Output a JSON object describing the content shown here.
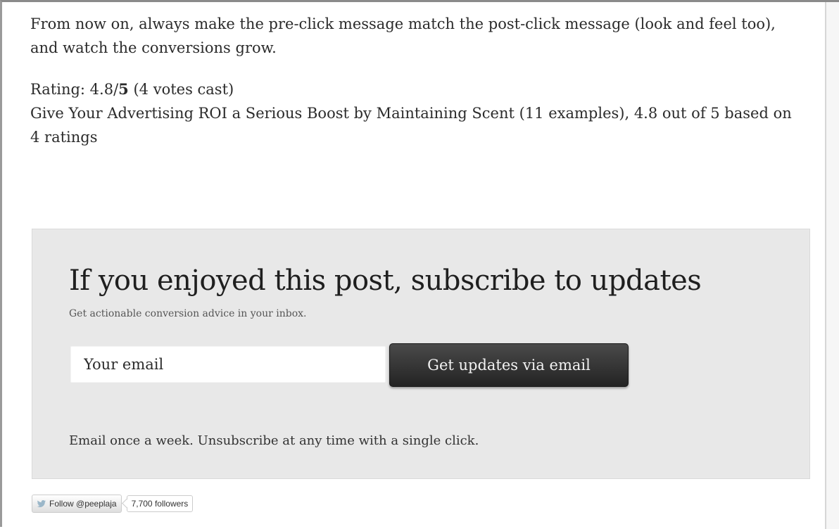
{
  "article": {
    "closing_paragraph": "From now on, always make the pre-click message match the post-click message (look and feel too), and watch the conversions grow.",
    "rating": {
      "prefix": "Rating: 4.8/",
      "max": "5",
      "votes": " (4 votes cast)",
      "value": 4.8,
      "scale": 5
    },
    "rating_summary": "Give Your Advertising ROI a Serious Boost by Maintaining Scent (11 examples), 4.8 out of 5 based on 4 ratings"
  },
  "subscribe": {
    "title": "If you enjoyed this post, subscribe to updates",
    "subtitle": "Get actionable conversion advice in your inbox.",
    "email_placeholder": "Your email",
    "button_label": "Get updates via email",
    "note": "Email once a week. Unsubscribe at any time with a single click."
  },
  "twitter": {
    "icon": "twitter-bird-icon",
    "follow_label": "Follow @peeplaja",
    "followers": "7,700 followers"
  },
  "colors": {
    "box_background": "#e8e8e8",
    "button_background": "#2f2f2f",
    "text": "#2b2b2b"
  }
}
